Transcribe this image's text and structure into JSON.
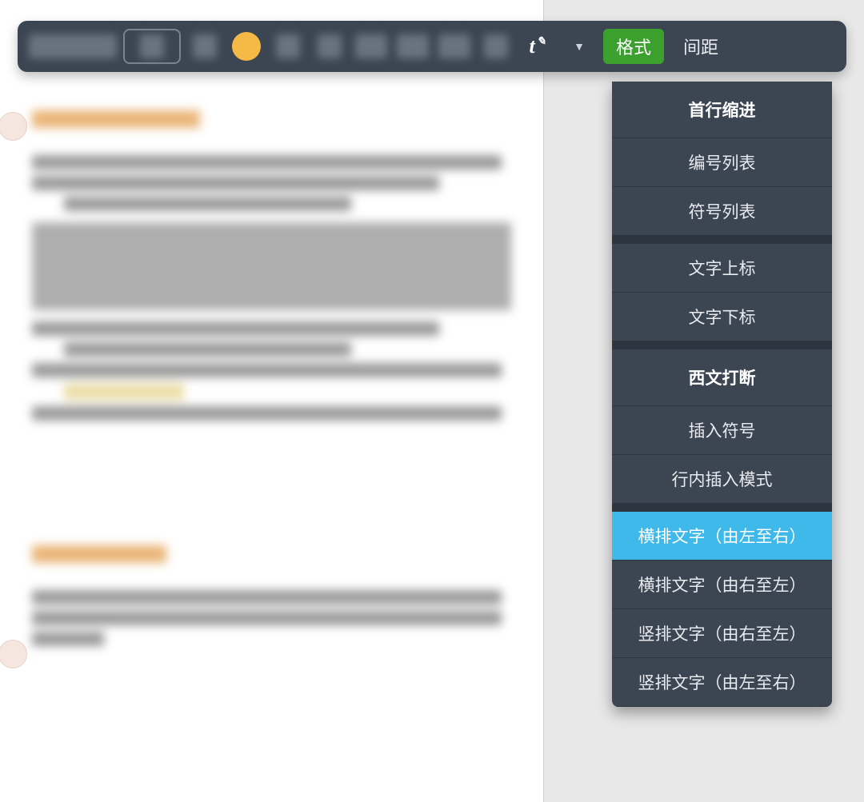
{
  "toolbar": {
    "text_tool_label": "t",
    "format_label": "格式",
    "spacing_label": "间距"
  },
  "dropdown": {
    "sections": [
      {
        "header": "首行缩进"
      },
      {
        "item": "编号列表"
      },
      {
        "item": "符号列表"
      },
      {
        "separator": true
      },
      {
        "item": "文字上标"
      },
      {
        "item": "文字下标"
      },
      {
        "separator": true
      },
      {
        "header": "西文打断"
      },
      {
        "item": "插入符号"
      },
      {
        "item": "行内插入模式"
      },
      {
        "separator": true
      },
      {
        "item": "横排文字（由左至右）",
        "selected": true
      },
      {
        "item": "横排文字（由右至左）"
      },
      {
        "item": "竖排文字（由右至左）"
      },
      {
        "item": "竖排文字（由左至右）"
      }
    ]
  }
}
